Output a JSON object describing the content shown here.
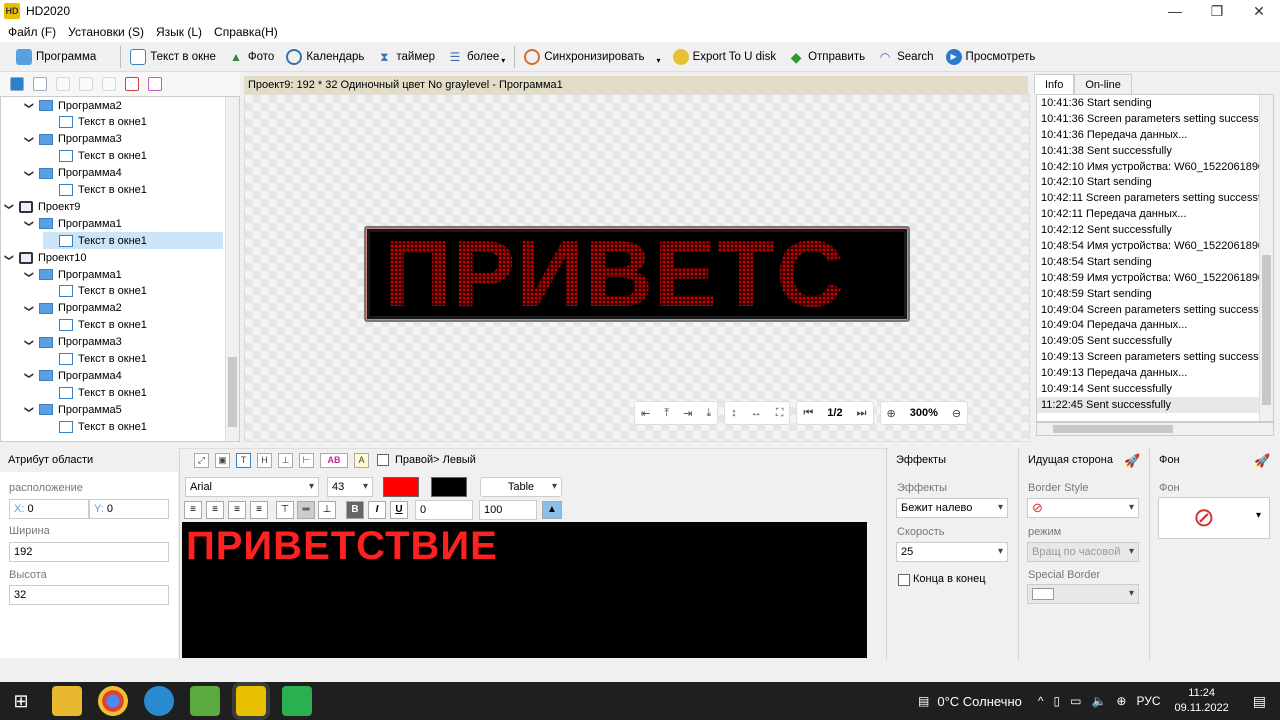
{
  "window": {
    "title": "HD2020",
    "logo": "HD",
    "minimize": "—",
    "maximize": "❐",
    "close": "✕"
  },
  "menu": [
    {
      "label": "Файл (F)"
    },
    {
      "label": "Установки (S)"
    },
    {
      "label": "Язык (L)"
    },
    {
      "label": "Справка(H)"
    }
  ],
  "toolbar": {
    "program": "Программа",
    "text_window": "Текст в окне",
    "photo": "Фото",
    "calendar": "Календарь",
    "timer": "таймер",
    "more": "более",
    "sync": "Синхронизировать",
    "export": "Export To U disk",
    "send": "Отправить",
    "search": "Search",
    "view": "Просмотреть"
  },
  "tree": [
    {
      "type": "program",
      "label": "Программа2",
      "level": 1
    },
    {
      "type": "text",
      "label": "Текст в окне1",
      "level": 2
    },
    {
      "type": "program",
      "label": "Программа3",
      "level": 1
    },
    {
      "type": "text",
      "label": "Текст в окне1",
      "level": 2
    },
    {
      "type": "program",
      "label": "Программа4",
      "level": 1
    },
    {
      "type": "text",
      "label": "Текст в окне1",
      "level": 2
    },
    {
      "type": "project",
      "label": "Проект9",
      "level": 0
    },
    {
      "type": "program",
      "label": "Программа1",
      "level": 1
    },
    {
      "type": "text",
      "label": "Текст в окне1",
      "level": 2,
      "selected": true
    },
    {
      "type": "project",
      "label": "Проект10",
      "level": 0
    },
    {
      "type": "program",
      "label": "Программа1",
      "level": 1
    },
    {
      "type": "text",
      "label": "Текст в окне1",
      "level": 2
    },
    {
      "type": "program",
      "label": "Программа2",
      "level": 1
    },
    {
      "type": "text",
      "label": "Текст в окне1",
      "level": 2
    },
    {
      "type": "program",
      "label": "Программа3",
      "level": 1
    },
    {
      "type": "text",
      "label": "Текст в окне1",
      "level": 2
    },
    {
      "type": "program",
      "label": "Программа4",
      "level": 1
    },
    {
      "type": "text",
      "label": "Текст в окне1",
      "level": 2
    },
    {
      "type": "program",
      "label": "Программа5",
      "level": 1
    },
    {
      "type": "text",
      "label": "Текст в окне1",
      "level": 2
    }
  ],
  "preview": {
    "header": "Проект9: 192 * 32 Одиночный цвет No graylevel - Программа1",
    "led_text": "ПРИВЕТС",
    "page": "1/2",
    "zoom": "300%"
  },
  "info": {
    "tabs": [
      "Info",
      "On-line"
    ],
    "log": [
      "10:41:36 Start sending",
      "10:41:36 Screen parameters setting successfu",
      "10:41:36 Передача данных...",
      "10:41:38 Sent successfully",
      "10:42:10 Имя устройства: W60_1522061890",
      "10:42:10 Start sending",
      "10:42:11 Screen parameters setting successfu",
      "10:42:11 Передача данных...",
      "10:42:12 Sent successfully",
      "10:48:54 Имя устройства: W60_1522061890",
      "10:48:54 Start sending",
      "10:48:59 Имя устройства: W60_1522061890",
      "10:48:59 Start sending",
      "10:49:04 Screen parameters setting successfu",
      "10:49:04 Передача данных...",
      "10:49:05 Sent successfully",
      "10:49:13 Screen parameters setting successfu",
      "10:49:13 Передача данных...",
      "10:49:14 Sent successfully",
      "11:22:45 Sent successfully"
    ]
  },
  "attr": {
    "title": "Атрибут области",
    "location_label": "расположение",
    "x_prefix": "X:",
    "x": "0",
    "y_prefix": "Y:",
    "y": "0",
    "width_label": "Ширина",
    "width": "192",
    "height_label": "Высота",
    "height": "32"
  },
  "editor": {
    "direction": "Правой> Левый",
    "font": "Arial",
    "size": "43",
    "fg_color": "#ff0000",
    "bg_color": "#000000",
    "table": "Table",
    "spacing": "0",
    "scale": "100",
    "text": "ПРИВЕТСТВИЕ",
    "bold": "B",
    "italic": "I",
    "underline": "U",
    "ab": "AB"
  },
  "effects": {
    "title": "Эффекты",
    "effects_label": "Эффекты",
    "effect": "Бежит налево",
    "speed_label": "Скорость",
    "speed": "25",
    "end_to_end": "Конца в конец"
  },
  "border": {
    "title": "Идущая сторона",
    "style_label": "Border Style",
    "mode_label": "режим",
    "mode": "Вращ по часовой",
    "special_label": "Special Border"
  },
  "background": {
    "title": "Фон",
    "label": "Фон"
  },
  "taskbar": {
    "weather": "0°C  Солнечно",
    "lang": "РУС",
    "time": "11:24",
    "date": "09.11.2022"
  }
}
